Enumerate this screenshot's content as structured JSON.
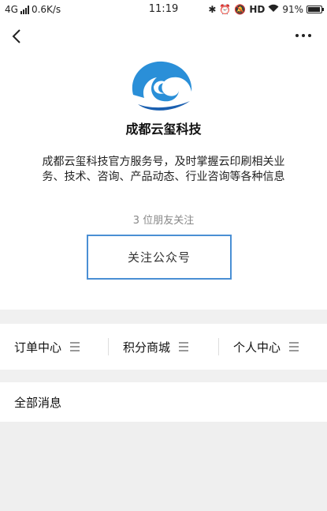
{
  "status_bar": {
    "network": "4G",
    "speed": "0.6K/s",
    "time": "11:19",
    "hd": "HD",
    "battery": "91%"
  },
  "nav": {
    "back_icon": "back-arrow-icon",
    "more_icon": "more-dots-icon"
  },
  "profile": {
    "name": "成都云玺科技",
    "description": "成都云玺科技官方服务号，及时掌握云印刷相关业务、技术、咨询、产品动态、行业咨询等各种信息",
    "friends_following": "3 位朋友关注",
    "follow_label": "关注公众号",
    "logo_colors": {
      "primary": "#2a8fd8",
      "dark": "#1a5fb0"
    }
  },
  "menu": {
    "items": [
      {
        "label": "订单中心",
        "icon": "hamburger-icon"
      },
      {
        "label": "积分商城",
        "icon": "hamburger-icon"
      },
      {
        "label": "个人中心",
        "icon": "hamburger-icon"
      }
    ]
  },
  "messages": {
    "all_label": "全部消息"
  }
}
